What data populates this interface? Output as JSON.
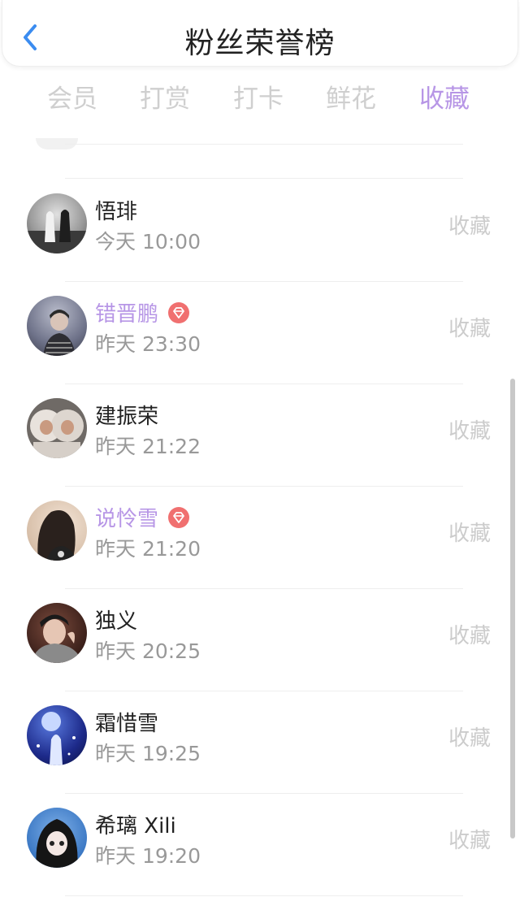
{
  "header": {
    "title": "粉丝荣誉榜",
    "back_icon": "chevron-left-icon"
  },
  "tabs": [
    {
      "label": "会员",
      "active": false
    },
    {
      "label": "打赏",
      "active": false
    },
    {
      "label": "打卡",
      "active": false
    },
    {
      "label": "鲜花",
      "active": false
    },
    {
      "label": "收藏",
      "active": true
    }
  ],
  "colors": {
    "accent": "#b796e6",
    "gem": "#f07070",
    "back": "#3b8cf0"
  },
  "fans": [
    {
      "name": "悟琲",
      "time": "今天 10:00",
      "vip": false,
      "action": "收藏"
    },
    {
      "name": "错晋鹏",
      "time": "昨天 23:30",
      "vip": true,
      "action": "收藏"
    },
    {
      "name": "建振荣",
      "time": "昨天 21:22",
      "vip": false,
      "action": "收藏"
    },
    {
      "name": "说怜雪",
      "time": "昨天 21:20",
      "vip": true,
      "action": "收藏"
    },
    {
      "name": "独义",
      "time": "昨天 20:25",
      "vip": false,
      "action": "收藏"
    },
    {
      "name": "霜惜雪",
      "time": "昨天 19:25",
      "vip": false,
      "action": "收藏"
    },
    {
      "name": "希璃 Xili",
      "time": "昨天 19:20",
      "vip": false,
      "action": "收藏"
    }
  ]
}
